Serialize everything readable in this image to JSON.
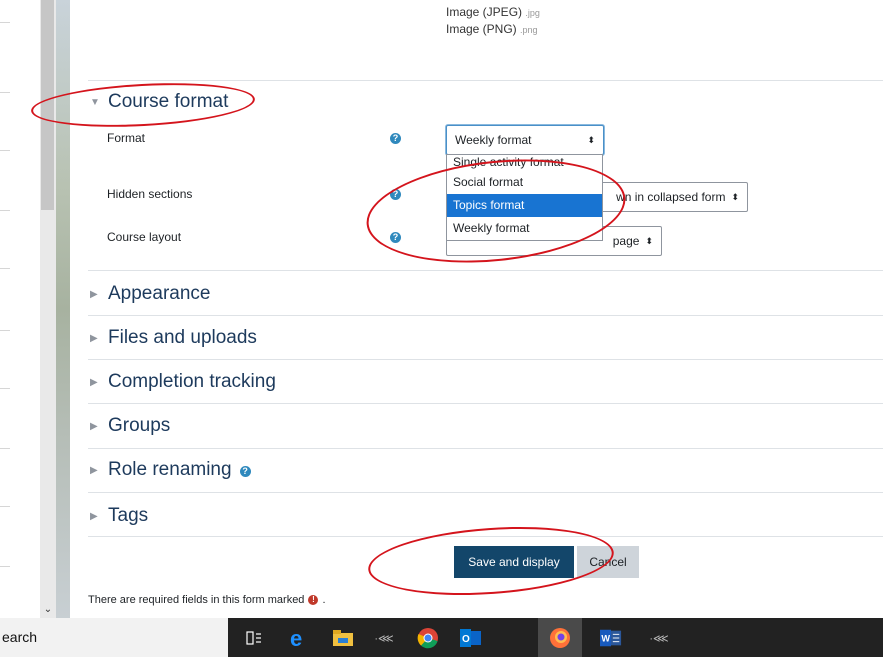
{
  "file_types": [
    {
      "label": "Image (JPEG)",
      "ext": ".jpg"
    },
    {
      "label": "Image (PNG)",
      "ext": ".png"
    }
  ],
  "course_format": {
    "heading": "Course format",
    "format_label": "Format",
    "format_value": "Weekly format",
    "format_options": [
      "Single activity format",
      "Social format",
      "Topics format",
      "Weekly format"
    ],
    "format_highlighted": "Topics format",
    "hidden_sections_label": "Hidden sections",
    "hidden_sections_value_visible": "wn in collapsed form",
    "course_layout_label": "Course layout",
    "course_layout_value_visible": "page"
  },
  "sections": {
    "appearance": "Appearance",
    "files_and_uploads": "Files and uploads",
    "completion_tracking": "Completion tracking",
    "groups": "Groups",
    "role_renaming": "Role renaming",
    "tags": "Tags"
  },
  "buttons": {
    "save_and_display": "Save and display",
    "cancel": "Cancel"
  },
  "required_note": "There are required fields in this form marked",
  "taskbar": {
    "search_text": "earch",
    "apps": [
      "task-view-icon",
      "edge-icon",
      "file-explorer-icon",
      "app-icon",
      "chrome-icon",
      "outlook-icon",
      "firefox-icon",
      "word-icon",
      "app-icon"
    ]
  },
  "colors": {
    "primary_button": "#13466a",
    "highlight": "#1874d2",
    "heading": "#1d3a5c",
    "annotation": "#d4141c",
    "help_icon": "#2f89bd"
  }
}
